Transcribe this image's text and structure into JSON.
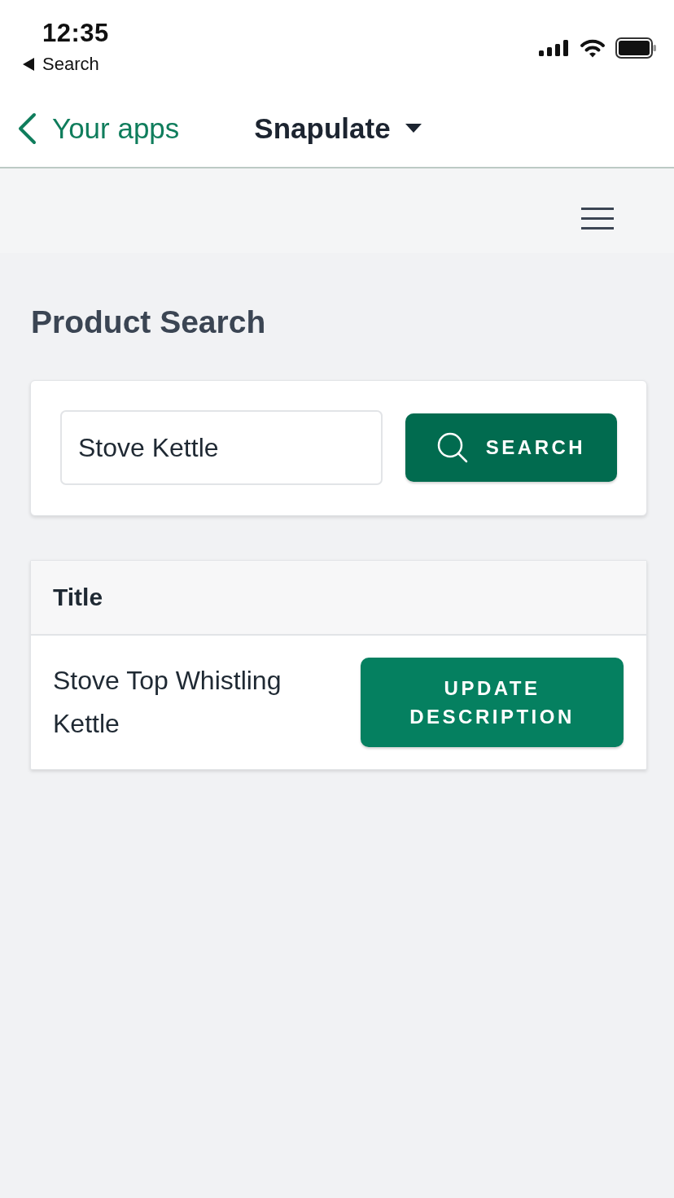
{
  "status_bar": {
    "time": "12:35",
    "back_label": "Search"
  },
  "nav_bar": {
    "back_label": "Your apps",
    "title": "Snapulate"
  },
  "page": {
    "heading": "Product Search"
  },
  "search": {
    "value": "Stove Kettle",
    "button": "SEARCH"
  },
  "table": {
    "columns": [
      "Title"
    ],
    "rows": [
      {
        "title": "Stove Top Whistling Kettle",
        "action": "UPDATE DESCRIPTION"
      }
    ]
  }
}
